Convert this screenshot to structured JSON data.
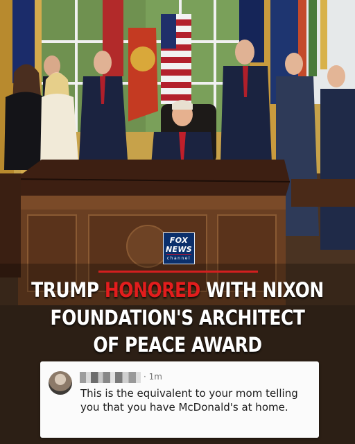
{
  "logo": {
    "line1": "FOX",
    "line2": "NEWS",
    "line3": "channel"
  },
  "headline": {
    "line1_part1": "TRUMP",
    "line1_highlight": "HONORED",
    "line1_part2": "WITH NIXON",
    "line2": "FOUNDATION'S ARCHITECT",
    "line3": "OF PEACE AWARD"
  },
  "comment": {
    "timestamp": "· 1m",
    "text": "This is the equivalent to your mom telling you that you have McDonald's at home."
  },
  "colors": {
    "highlight": "#e21d1d",
    "fox_blue": "#0b2f6b",
    "rule": "#d31f1f"
  }
}
